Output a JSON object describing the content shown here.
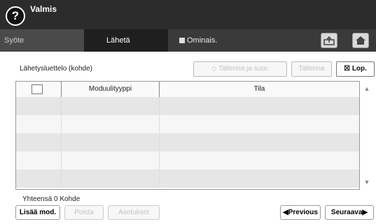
{
  "header": {
    "help_icon": "?",
    "status": "Valmis"
  },
  "tabs": {
    "input": "Syöte",
    "send": "Lähetä",
    "options": "Ominais."
  },
  "main": {
    "list_label": "Lähetysluettelo (kohde)",
    "save_run": "Tallenna ja suor.",
    "save": "Tallenna",
    "close": "Lop.",
    "columns": [
      "",
      "Moduulityyppi",
      "Tila"
    ],
    "total": "Yhteensä 0 Kohde"
  },
  "footer": {
    "add_module": "Lisää mod.",
    "delete": "Poista",
    "settings": "Asetukset",
    "previous": "Previous",
    "next": "Seuraava"
  },
  "colors": {
    "header_bg": "#2c2c2c",
    "row_shade": "#e6e6e6",
    "row_light": "#f6f6f6"
  },
  "icons": [
    "help-icon",
    "upload-icon",
    "home-icon",
    "options-icon",
    "save-run-icon",
    "close-icon",
    "scroll-up-icon",
    "scroll-down-icon",
    "prev-arrow-icon",
    "next-arrow-icon"
  ]
}
